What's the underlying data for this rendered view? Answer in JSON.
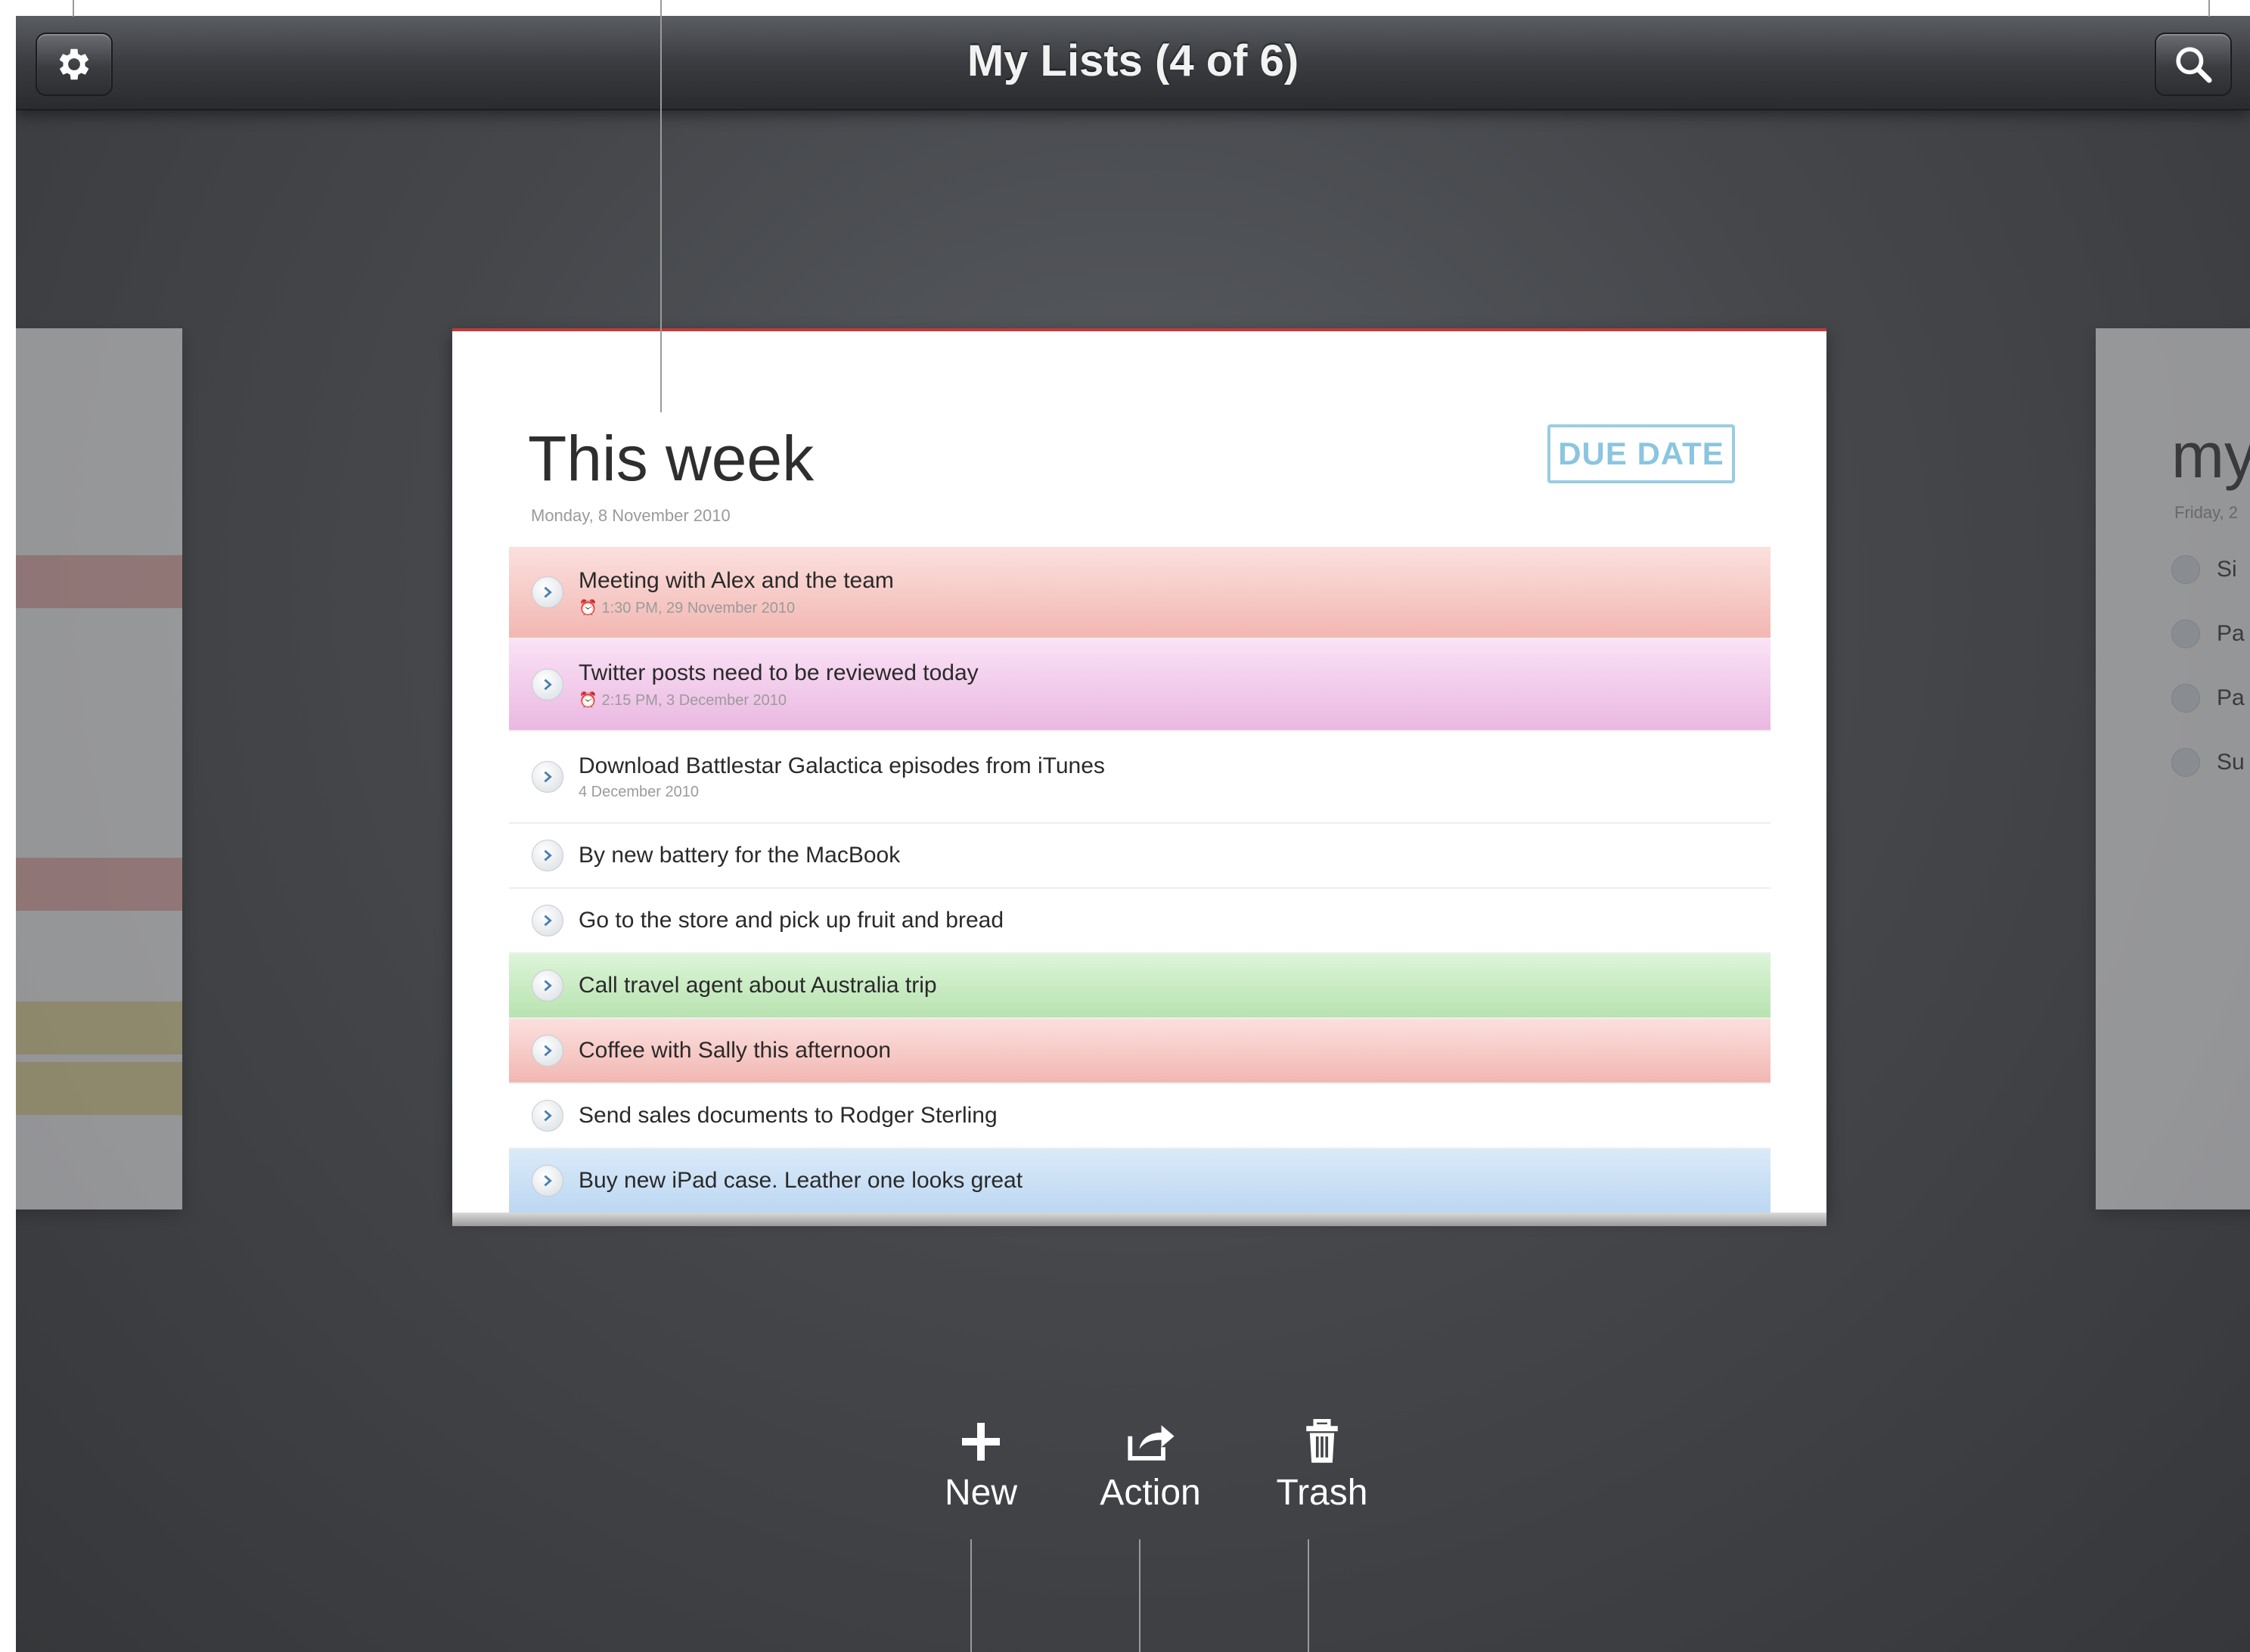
{
  "header": {
    "title": "My Lists (4 of 6)",
    "left_button_icon": "gear-icon",
    "right_button_icon": "search-icon"
  },
  "main_list": {
    "title": "This week",
    "date": "Monday, 8 November 2010",
    "stamp": "DUE DATE",
    "tasks": [
      {
        "title": "Meeting with Alex and the team",
        "sub": "⏰ 1:30 PM, 29 November 2010",
        "color": "red"
      },
      {
        "title": "Twitter posts need to be reviewed today",
        "sub": "⏰ 2:15 PM, 3 December 2010",
        "color": "pink"
      },
      {
        "title": "Download Battlestar Galactica episodes from iTunes",
        "sub": "4 December 2010",
        "color": "none"
      },
      {
        "title": "By new battery for the MacBook",
        "sub": "",
        "color": "none"
      },
      {
        "title": "Go to the store and pick up fruit and bread",
        "sub": "",
        "color": "none"
      },
      {
        "title": "Call travel agent about Australia trip",
        "sub": "",
        "color": "green"
      },
      {
        "title": "Coffee with Sally this afternoon",
        "sub": "",
        "color": "red"
      },
      {
        "title": "Send sales documents to Rodger Sterling",
        "sub": "",
        "color": "none"
      },
      {
        "title": "Buy new iPad case. Leather one looks great",
        "sub": "",
        "color": "blue"
      }
    ]
  },
  "right_card": {
    "title": "my",
    "sub": "Friday, 2",
    "rows": [
      "Si",
      "Pa",
      "Pa",
      "Su"
    ]
  },
  "toolbar": {
    "new_label": "New",
    "action_label": "Action",
    "trash_label": "Trash"
  },
  "colors": {
    "red": "#f2b7b2",
    "pink": "#eab8e2",
    "green": "#b8e3b0",
    "blue": "#bcd7f2",
    "stamp": "#7fbfdc",
    "accent_line": "#c43a3a"
  }
}
